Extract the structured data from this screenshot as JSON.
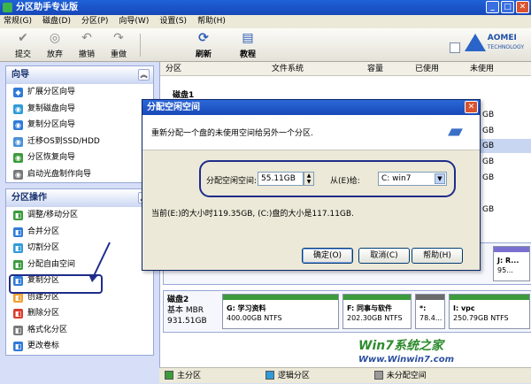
{
  "window": {
    "title": "分区助手专业版"
  },
  "menu": [
    "常规(G)",
    "磁盘(D)",
    "分区(P)",
    "向导(W)",
    "设置(S)",
    "帮助(H)"
  ],
  "toolbar": {
    "buttons": [
      {
        "label": "提交",
        "icon": "checkmark-icon"
      },
      {
        "label": "放弃",
        "icon": "discard-icon"
      },
      {
        "label": "撤销",
        "icon": "undo-icon"
      },
      {
        "label": "重做",
        "icon": "redo-icon"
      },
      {
        "label": "刷新",
        "icon": "refresh-icon"
      },
      {
        "label": "教程",
        "icon": "tutorial-icon"
      }
    ],
    "logo": "AOMEI",
    "logo_sub": "TECHNOLOGY"
  },
  "wizard_panel": {
    "title": "向导",
    "items": [
      "扩展分区向导",
      "复制磁盘向导",
      "复制分区向导",
      "迁移OS到SSD/HDD",
      "分区恢复向导",
      "启动光盘制作向导"
    ]
  },
  "ops_panel": {
    "title": "分区操作",
    "items": [
      "调整/移动分区",
      "合并分区",
      "切割分区",
      "分配自由空间",
      "复制分区",
      "创建分区",
      "删除分区",
      "格式化分区",
      "更改卷标"
    ]
  },
  "columns": [
    "分区",
    "文件系统",
    "容量",
    "已使用",
    "未使用"
  ],
  "disk1_label": "磁盘1",
  "right_values": [
    "GB",
    "GB",
    "GB",
    "GB",
    "GB",
    "GB"
  ],
  "disk1_box": {
    "label": "J: R...",
    "size": "95..."
  },
  "disk2": {
    "name": "磁盘2",
    "type": "基本 MBR",
    "size": "931.51GB",
    "partitions": [
      {
        "label": "G: 学习资料",
        "detail": "400.00GB NTFS"
      },
      {
        "label": "F: 同事与软件",
        "detail": "202.30GB NTFS"
      },
      {
        "label": "*:",
        "detail": "78.4..."
      },
      {
        "label": "I: vpc",
        "detail": "250.79GB NTFS"
      }
    ]
  },
  "legend": [
    "主分区",
    "逻辑分区",
    "未分配空间"
  ],
  "dialog": {
    "title": "分配空闲空间",
    "desc": "重新分配一个盘的未使用空间给另外一个分区.",
    "alloc_label": "分配空闲空间:",
    "alloc_value": "55.11GB",
    "from_label": "从(E)给:",
    "from_value": "C: win7",
    "info": "当前(E:)的大小时119.35GB, (C:)盘的大小是117.11GB.",
    "ok": "确定(O)",
    "cancel": "取消(C)",
    "help": "帮助(H)"
  },
  "watermark": {
    "line1": "Win7系统之家",
    "line2": "Www.Winwin7.com"
  }
}
